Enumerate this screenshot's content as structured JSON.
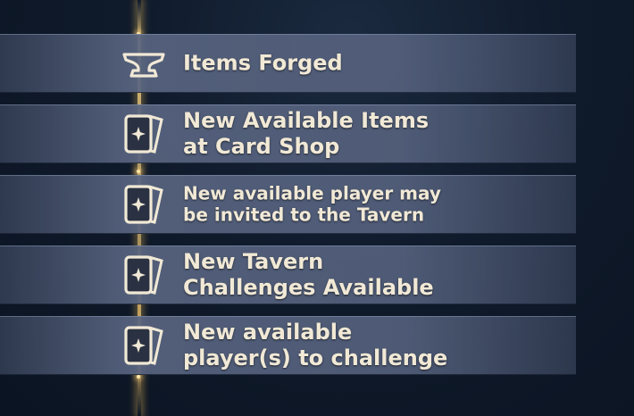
{
  "notifications": [
    {
      "icon": "anvil-icon",
      "lines": [
        "Items Forged"
      ]
    },
    {
      "icon": "card-icon",
      "lines": [
        "New Available Items",
        "at Card Shop"
      ]
    },
    {
      "icon": "card-icon",
      "lines": [
        "New available player may",
        "be invited to the Tavern"
      ]
    },
    {
      "icon": "card-icon",
      "lines": [
        "New Tavern",
        "Challenges Available"
      ]
    },
    {
      "icon": "card-icon",
      "lines": [
        "New available",
        "player(s) to challenge"
      ]
    }
  ],
  "colors": {
    "text": "#f1e9d6",
    "accent_glow": "#ffd782",
    "row_bg": "#58647f"
  }
}
